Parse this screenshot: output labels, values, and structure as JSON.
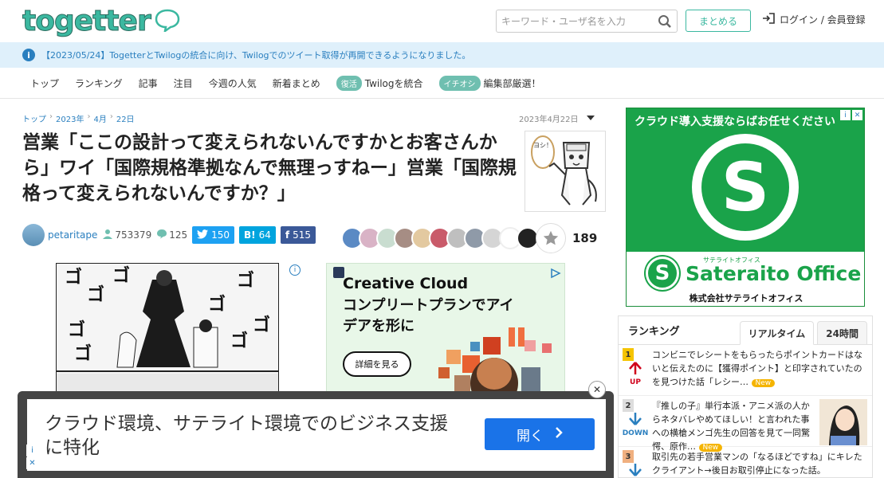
{
  "header": {
    "logo_text": "togetter",
    "search_placeholder": "キーワード・ユーザ名を入力",
    "matomeru_label": "まとめる",
    "login_label": "ログイン / 会員登録"
  },
  "notice": {
    "text": "【2023/05/24】TogetterとTwilogの統合に向け、Twilogでのツイート取得が再開できるようになりました。"
  },
  "nav": {
    "items": [
      "トップ",
      "ランキング",
      "記事",
      "注目",
      "今週の人気",
      "新着まとめ"
    ],
    "badge1": "復活",
    "badge1_label": "Twilogを統合",
    "badge2": "イチオシ",
    "badge2_label": "編集部厳選！"
  },
  "breadcrumb": [
    "トップ",
    "2023年",
    "4月",
    "22日"
  ],
  "article": {
    "date": "2023年4月22日",
    "title": "営業「ここの設計って変えられないんですかとお客さんから」ワイ「国際規格準拠なんで無理っすねー」営業「国際規格って変えられないんですか？」",
    "thumb_caption": "ヨシ！",
    "author": "petaritape",
    "views": "753379",
    "comments": "125",
    "twitter_count": "150",
    "hatena_label": "B!",
    "hatena_count": "64",
    "facebook_count": "515",
    "favorites": "189"
  },
  "ad_cc": {
    "title": "Creative Cloud",
    "subtitle": "コンプリートプランでアイデアを形に",
    "button": "詳細を見る"
  },
  "ad_sateraito": {
    "headline": "クラウド導入支援ならばお任せください",
    "brand": "Sateraito Office",
    "brand_small": "サテライトオフィス",
    "company": "株式会社サテライトオフィス",
    "letter": "S"
  },
  "ranking": {
    "title": "ランキング",
    "tabs": [
      "リアルタイム",
      "24時間"
    ],
    "items": [
      {
        "num": "1",
        "dir": "UP",
        "text": "コンビニでレシートをもらったらポイントカードはないと伝えたのに【獲得ポイント】と印字されていたのを見つけた話「レシー…",
        "new": "New"
      },
      {
        "num": "2",
        "dir": "DOWN",
        "text": "『推しの子』単行本派・アニメ派の人からネタバレやめてほしい！と言われた事への横槍メンゴ先生の回答を見て一同驚愕、原作…",
        "new": "New"
      },
      {
        "num": "3",
        "dir": "",
        "text": "取引先の若手営業マンの「なるほどですね」にキレたクライアント→後日お取引停止になった話。",
        "new": ""
      }
    ]
  },
  "banner": {
    "text": "クラウド環境、サテライト環境でのビジネス支援に特化",
    "button": "開く"
  },
  "colors": {
    "accent": "#3bb8a0",
    "link": "#2a7fbf",
    "twitter": "#1da1f2",
    "hatena": "#00a4de",
    "facebook": "#3b5998",
    "sateraito_green": "#1aa34a",
    "up": "#d0021b",
    "down": "#2a7fbf"
  }
}
